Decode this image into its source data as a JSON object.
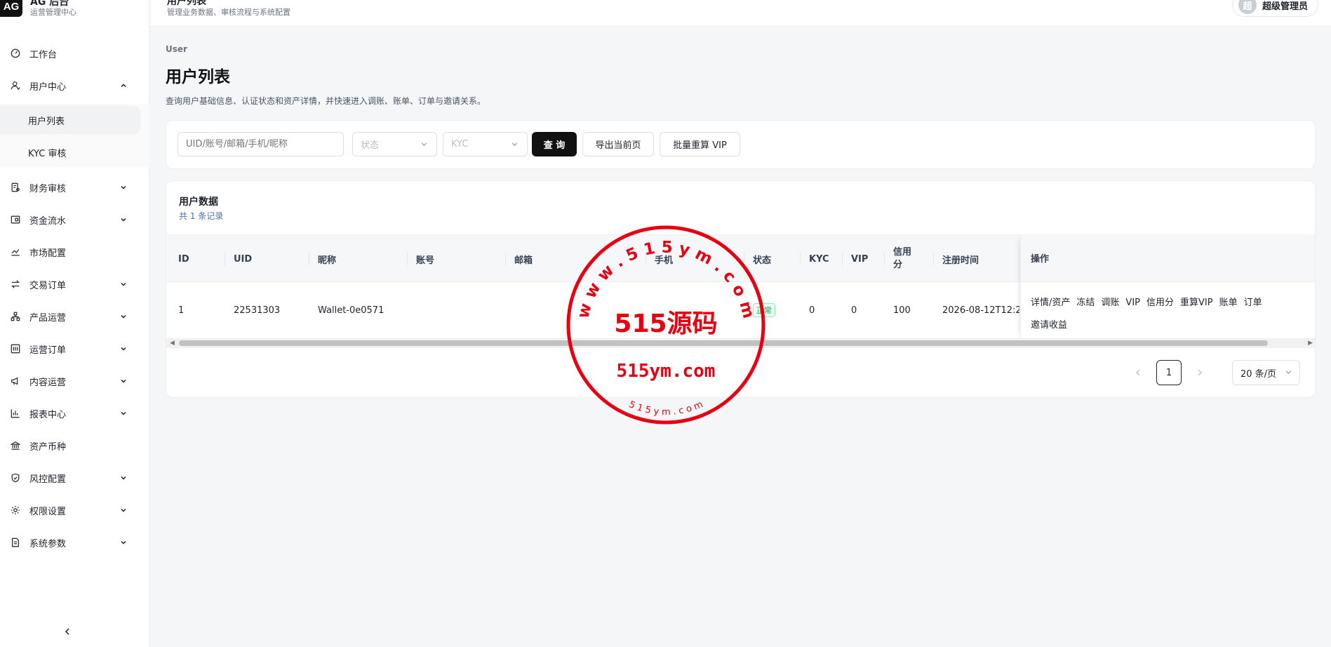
{
  "brand": {
    "logo": "AG",
    "name": "AG 后台",
    "subtitle": "运营管理中心"
  },
  "header": {
    "title": "用户列表",
    "subtitle": "管理业务数据、审核流程与系统配置",
    "user_avatar": "超",
    "user_name": "超级管理员"
  },
  "sidebar": {
    "items": [
      {
        "label": "工作台",
        "icon": "dashboard-icon"
      },
      {
        "label": "用户中心",
        "icon": "user-icon"
      },
      {
        "label": "用户列表"
      },
      {
        "label": "KYC 审核"
      },
      {
        "label": "财务审核",
        "icon": "audit-icon"
      },
      {
        "label": "资金流水",
        "icon": "wallet-icon"
      },
      {
        "label": "市场配置",
        "icon": "chart-line-icon"
      },
      {
        "label": "交易订单",
        "icon": "swap-icon"
      },
      {
        "label": "产品运营",
        "icon": "hierarchy-icon"
      },
      {
        "label": "运营订单",
        "icon": "orders-icon"
      },
      {
        "label": "内容运营",
        "icon": "megaphone-icon"
      },
      {
        "label": "报表中心",
        "icon": "bar-chart-icon"
      },
      {
        "label": "资产币种",
        "icon": "bank-icon"
      },
      {
        "label": "风控配置",
        "icon": "shield-icon"
      },
      {
        "label": "权限设置",
        "icon": "gear-icon"
      },
      {
        "label": "系统参数",
        "icon": "document-icon"
      }
    ]
  },
  "page": {
    "breadcrumb": "User",
    "title": "用户列表",
    "description": "查询用户基础信息、认证状态和资产详情，并快速进入调账、账单、订单与邀请关系。"
  },
  "filters": {
    "search_placeholder": "UID/账号/邮箱/手机/昵称",
    "status_placeholder": "状态",
    "kyc_placeholder": "KYC",
    "query_label": "查 询",
    "export_label": "导出当前页",
    "recalc_label": "批量重算 VIP"
  },
  "table": {
    "title": "用户数据",
    "count_text": "共 1 条记录",
    "columns": [
      "ID",
      "UID",
      "昵称",
      "账号",
      "邮箱",
      "手机",
      "状态",
      "KYC",
      "VIP",
      "信用分",
      "注册时间",
      "操作"
    ],
    "rows": [
      {
        "id": "1",
        "uid": "22531303",
        "nickname": "Wallet-0e0571",
        "account": "",
        "email": "",
        "phone": "",
        "status": "正常",
        "kyc": "0",
        "vip": "0",
        "credit": "100",
        "registered": "2026-08-12T12:2"
      }
    ],
    "actions": [
      "详情/资产",
      "冻结",
      "调账",
      "VIP",
      "信用分",
      "重算VIP",
      "账单",
      "订单",
      "邀请收益"
    ]
  },
  "pagination": {
    "current_page": "1",
    "page_size": "20 条/页"
  },
  "watermark": {
    "top_text": "w w w . 5 1 5 y m . c o m",
    "center_text": "515源码",
    "domain_text": "515ym.com",
    "bottom_text": "5 1 5 y m . c o m",
    "color": "#e60012"
  }
}
